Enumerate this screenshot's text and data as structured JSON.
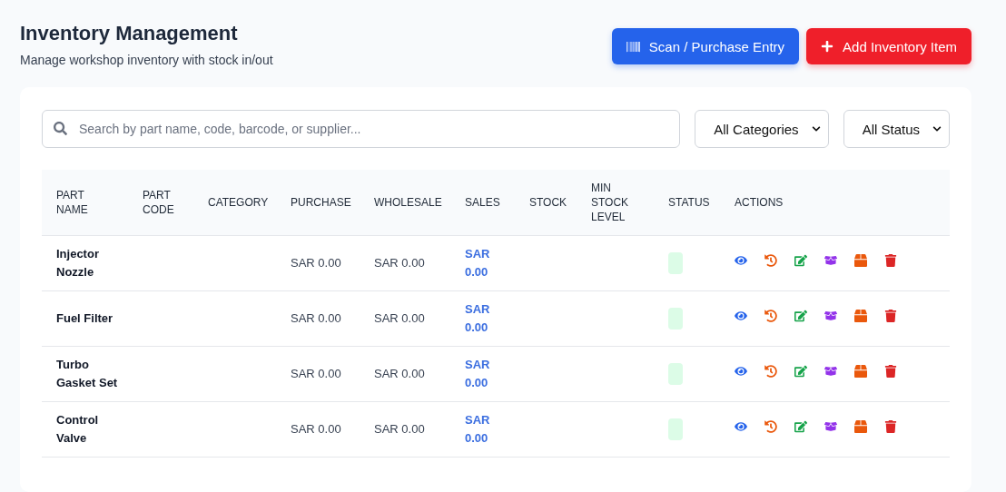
{
  "header": {
    "title": "Inventory Management",
    "subtitle": "Manage workshop inventory with stock in/out"
  },
  "buttons": [
    {
      "kind": "scan",
      "label": "Scan / Purchase Entry"
    },
    {
      "kind": "add",
      "label": "Add Inventory Item"
    }
  ],
  "search": {
    "placeholder": "Search by part name, code, barcode, or supplier..."
  },
  "filters": [
    {
      "label": "All Categories"
    },
    {
      "label": "All Status"
    }
  ],
  "table": {
    "columns": [
      "PART NAME",
      "PART CODE",
      "CATEGORY",
      "PURCHASE",
      "WHOLESALE",
      "SALES",
      "STOCK",
      "MIN STOCK LEVEL",
      "STATUS",
      "ACTIONS"
    ],
    "rows": [
      {
        "name": "Injector Nozzle",
        "purchase": "SAR 0.00",
        "wholesale": "SAR 0.00",
        "sales": "SAR 0.00"
      },
      {
        "name": "Fuel Filter",
        "purchase": "SAR 0.00",
        "wholesale": "SAR 0.00",
        "sales": "SAR 0.00"
      },
      {
        "name": "Turbo Gasket Set",
        "purchase": "SAR 0.00",
        "wholesale": "SAR 0.00",
        "sales": "SAR 0.00"
      },
      {
        "name": "Control Valve",
        "purchase": "SAR 0.00",
        "wholesale": "SAR 0.00",
        "sales": "SAR 0.00"
      }
    ]
  }
}
